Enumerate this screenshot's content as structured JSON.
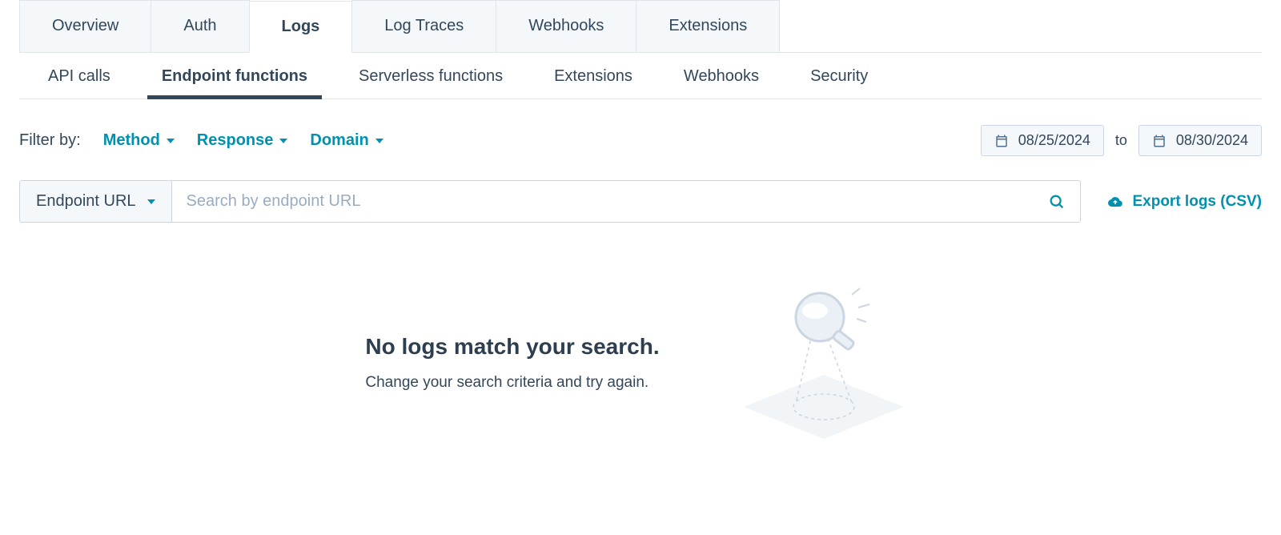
{
  "primaryTabs": {
    "overview": "Overview",
    "auth": "Auth",
    "logs": "Logs",
    "logTraces": "Log Traces",
    "webhooks": "Webhooks",
    "extensions": "Extensions"
  },
  "secondaryTabs": {
    "apiCalls": "API calls",
    "endpointFunctions": "Endpoint functions",
    "serverlessFunctions": "Serverless functions",
    "extensions": "Extensions",
    "webhooks": "Webhooks",
    "security": "Security"
  },
  "filters": {
    "label": "Filter by:",
    "method": "Method",
    "response": "Response",
    "domain": "Domain"
  },
  "dateRange": {
    "from": "08/25/2024",
    "toLabel": "to",
    "to": "08/30/2024"
  },
  "search": {
    "dropdown": "Endpoint URL",
    "placeholder": "Search by endpoint URL"
  },
  "export": {
    "label": "Export logs (CSV)"
  },
  "emptyState": {
    "title": "No logs match your search.",
    "subtitle": "Change your search criteria and try again."
  }
}
